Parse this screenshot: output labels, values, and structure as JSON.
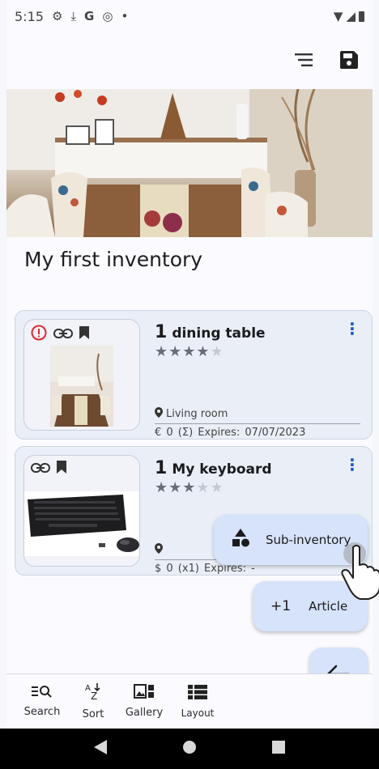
{
  "status_bar": {
    "time": "5:15",
    "icons": [
      "settings-icon",
      "download-icon",
      "google-icon",
      "vpn-icon",
      "dot-icon",
      "wifi-icon",
      "signal-icon",
      "battery-icon"
    ],
    "dot": "•"
  },
  "appbar": {
    "icons": [
      "sort-lines-icon",
      "save-icon"
    ]
  },
  "inventory": {
    "title": "My first inventory"
  },
  "articles": [
    {
      "quantity": "1",
      "name": "dining table",
      "rating": 4,
      "rating_max": 5,
      "location": "Living room",
      "price_line": "€ 0  (Σ)   Expires: 07/07/2023",
      "icons": [
        "alert-icon",
        "link-icon",
        "bookmark-icon"
      ],
      "alert_color": "#e0292e"
    },
    {
      "quantity": "1",
      "name": "My keyboard",
      "rating": 3,
      "rating_max": 5,
      "location": "",
      "price_line": "$ 0  (x1)   Expires: -",
      "icons": [
        "link-icon",
        "bookmark-icon"
      ]
    }
  ],
  "fabs": {
    "sub_inventory": "Sub-inventory",
    "article_prefix": "+1",
    "article": "Article",
    "back_icon": "arrow-left-icon"
  },
  "bottom_nav": [
    {
      "label": "Search",
      "icon": "search-list-icon"
    },
    {
      "label": "Sort",
      "icon": "sort-az-icon"
    },
    {
      "label": "Gallery",
      "icon": "gallery-icon"
    },
    {
      "label": "Layout",
      "icon": "list-layout-icon"
    }
  ],
  "colors": {
    "accent": "#1a57c8",
    "fab_bg": "#d6e3fa",
    "card_bg": "#e9eef7"
  }
}
